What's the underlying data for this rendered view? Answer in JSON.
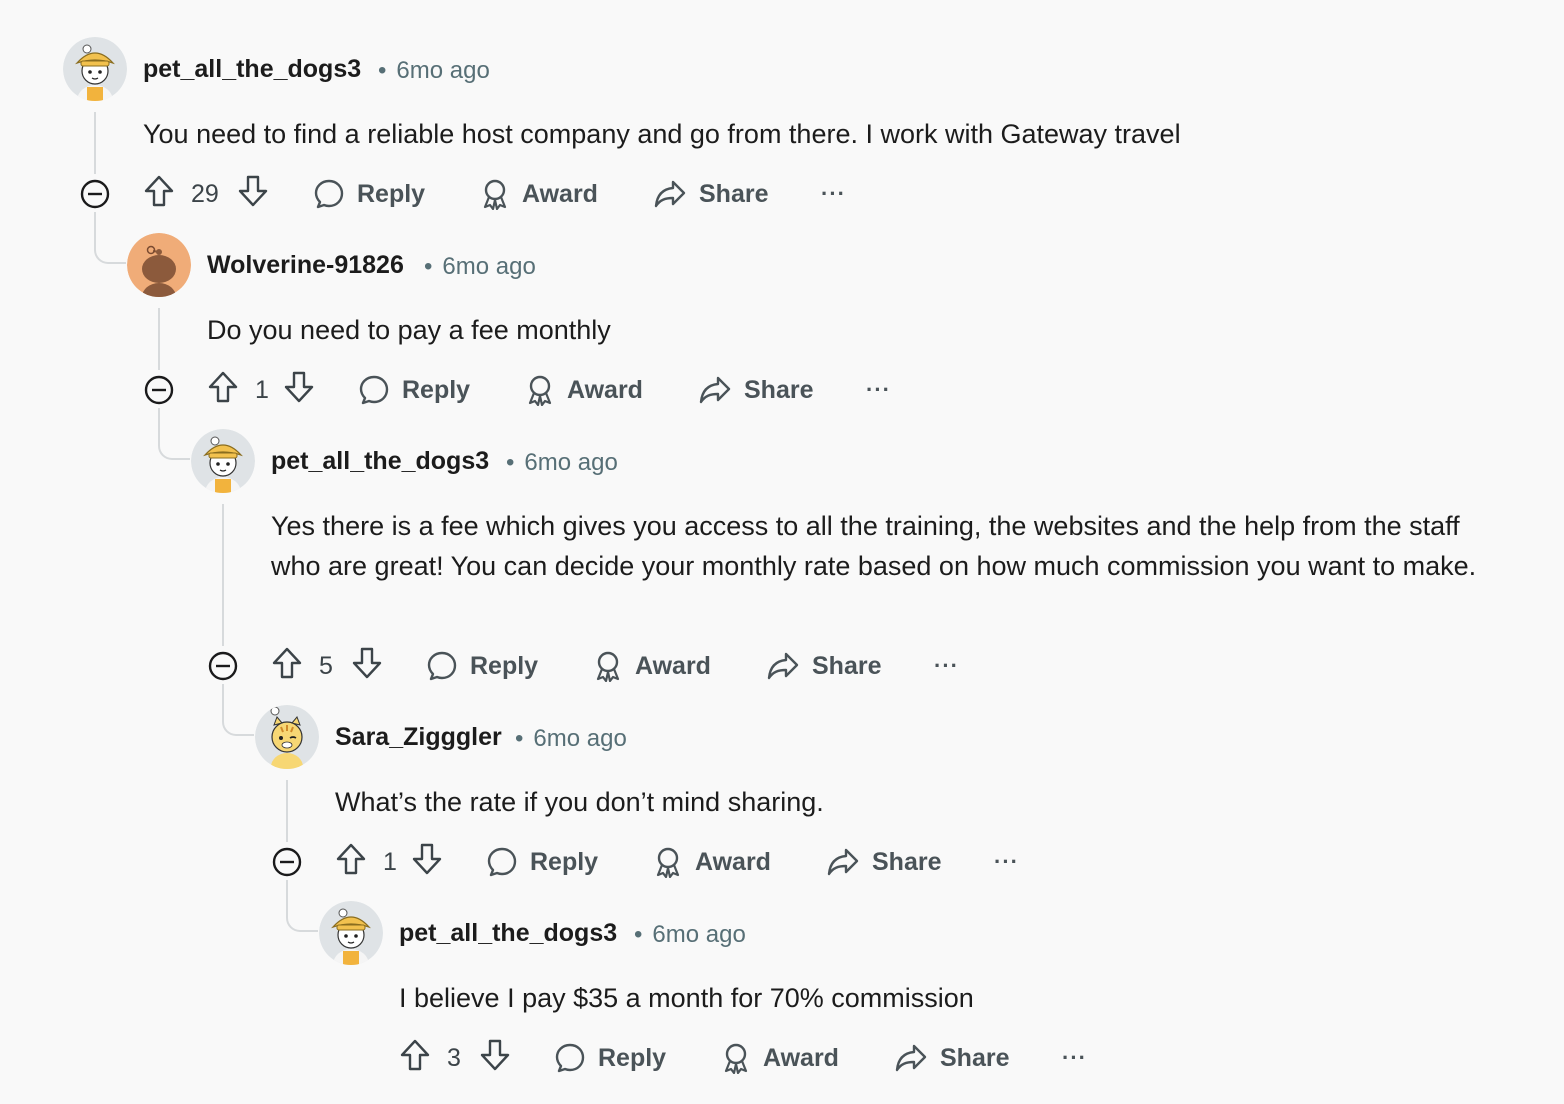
{
  "comments": [
    {
      "username": "pet_all_the_dogs3",
      "time": "6mo ago",
      "body": "You need to find a reliable host company and go from there. I work with Gateway travel",
      "votes": "29",
      "avatar": "yellow-hat-avatar"
    },
    {
      "username": "Wolverine-91826",
      "time": "6mo ago",
      "body": "Do you need to pay a fee monthly",
      "votes": "1",
      "avatar": "default-snoo-avatar"
    },
    {
      "username": "pet_all_the_dogs3",
      "time": "6mo ago",
      "body": "Yes there is a fee which gives you access to all the training, the websites and the help from the staff who are great! You can decide your monthly rate based on how much commission you want to make.",
      "votes": "5",
      "avatar": "yellow-hat-avatar"
    },
    {
      "username": "Sara_Zigggler",
      "time": "6mo ago",
      "body": "What’s the rate if you don’t mind sharing.",
      "votes": "1",
      "avatar": "tiger-avatar"
    },
    {
      "username": "pet_all_the_dogs3",
      "time": "6mo ago",
      "body": "I believe I pay $35 a month for 70% commission",
      "votes": "3",
      "avatar": "yellow-hat-avatar"
    }
  ],
  "actions": {
    "reply": "Reply",
    "award": "Award",
    "share": "Share",
    "more": "···",
    "separator": "•"
  },
  "colors": {
    "background": "#f9f9f9",
    "thread_line": "#d7dadc",
    "meta_text": "#576f76"
  }
}
